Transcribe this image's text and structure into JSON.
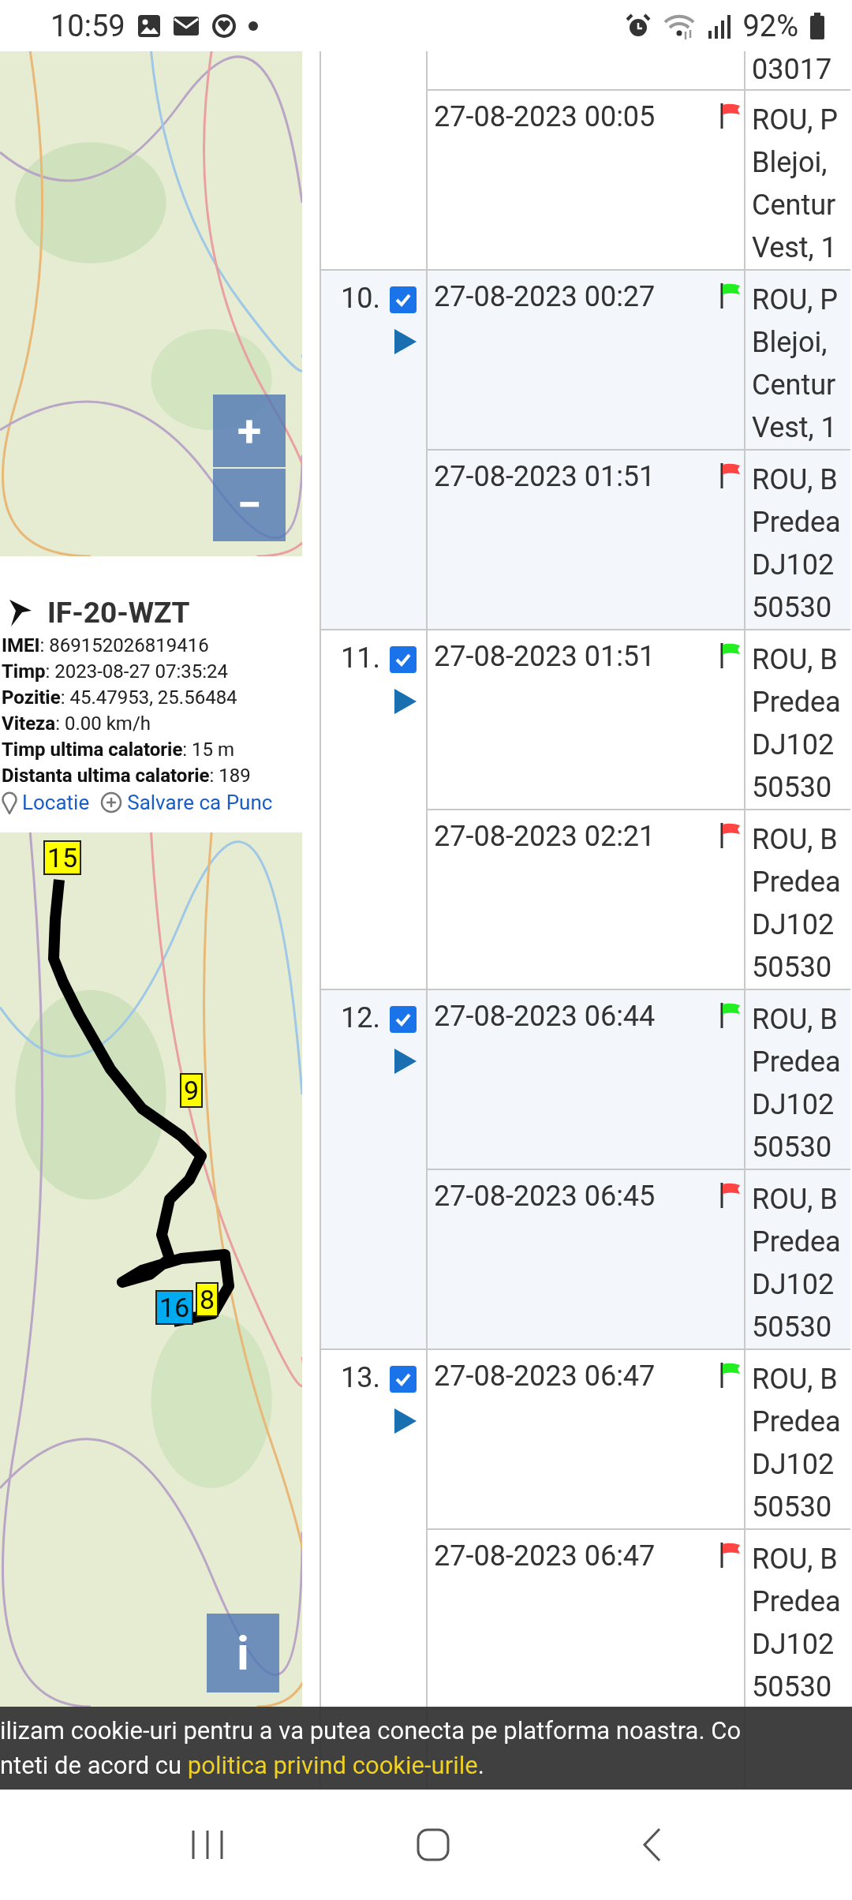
{
  "status_bar": {
    "time": "10:59",
    "battery": "92%"
  },
  "top_map": {
    "zoom_in": "+",
    "zoom_out": "−"
  },
  "vehicle": {
    "name": "IF-20-WZT",
    "fields": [
      "**IMEI**: 869152026819416",
      "**Timp**: 2023-08-27 07:35:24",
      "**Pozitie**: 45.47953, 25.56484",
      "**Viteza**: 0.00 km/h",
      "**Timp ultima calatorie**: 15 m",
      "**Distanta ultima calatorie**: 189"
    ],
    "links": [
      {
        "label": "Locatie",
        "kind": "location"
      },
      {
        "label": "Salvare ca Punc",
        "kind": "save"
      }
    ]
  },
  "route_map": {
    "markers": [
      {
        "label": "15",
        "color": "#ffff00"
      },
      {
        "label": "9",
        "color": "#ffff00"
      },
      {
        "label": "16",
        "color": "#00aaee"
      },
      {
        "label": "8",
        "color": "#ffff00"
      }
    ],
    "info_button": "i"
  },
  "trips": [
    {
      "segments": [
        {
          "address": [
            "03017"
          ]
        },
        {
          "time": "27-08-2023 00:05",
          "kind": "end",
          "address": [
            "ROU, P",
            "Blejoi,",
            "Centur",
            "Vest, 1"
          ]
        }
      ]
    },
    {
      "number": "10.",
      "checked": true,
      "segments": [
        {
          "time": "27-08-2023 00:27",
          "kind": "start",
          "address": [
            "ROU, P",
            "Blejoi,",
            "Centur",
            "Vest, 1"
          ]
        },
        {
          "time": "27-08-2023 01:51",
          "kind": "end",
          "address": [
            "ROU, B",
            "Predea",
            "DJ102",
            "50530"
          ]
        }
      ]
    },
    {
      "number": "11.",
      "checked": true,
      "segments": [
        {
          "time": "27-08-2023 01:51",
          "kind": "start",
          "address": [
            "ROU, B",
            "Predea",
            "DJ102",
            "50530"
          ]
        },
        {
          "time": "27-08-2023 02:21",
          "kind": "end",
          "address": [
            "ROU, B",
            "Predea",
            "DJ102",
            "50530"
          ]
        }
      ]
    },
    {
      "number": "12.",
      "checked": true,
      "segments": [
        {
          "time": "27-08-2023 06:44",
          "kind": "start",
          "address": [
            "ROU, B",
            "Predea",
            "DJ102",
            "50530"
          ]
        },
        {
          "time": "27-08-2023 06:45",
          "kind": "end",
          "address": [
            "ROU, B",
            "Predea",
            "DJ102",
            "50530"
          ]
        }
      ]
    },
    {
      "number": "13.",
      "checked": true,
      "segments": [
        {
          "time": "27-08-2023 06:47",
          "kind": "start",
          "address": [
            "ROU, B",
            "Predea",
            "DJ102",
            "50530"
          ]
        },
        {
          "time": "27-08-2023 06:47",
          "kind": "end",
          "address": [
            "ROU, B",
            "Predea",
            "DJ102",
            "50530"
          ]
        }
      ]
    }
  ],
  "cookie_banner": {
    "line_1": "ilizam cookie-uri pentru a va putea conecta pe platforma noastra. Co",
    "line_2": "nteti de acord cu ",
    "link": "politica privind cookie-urile",
    "end": "."
  }
}
